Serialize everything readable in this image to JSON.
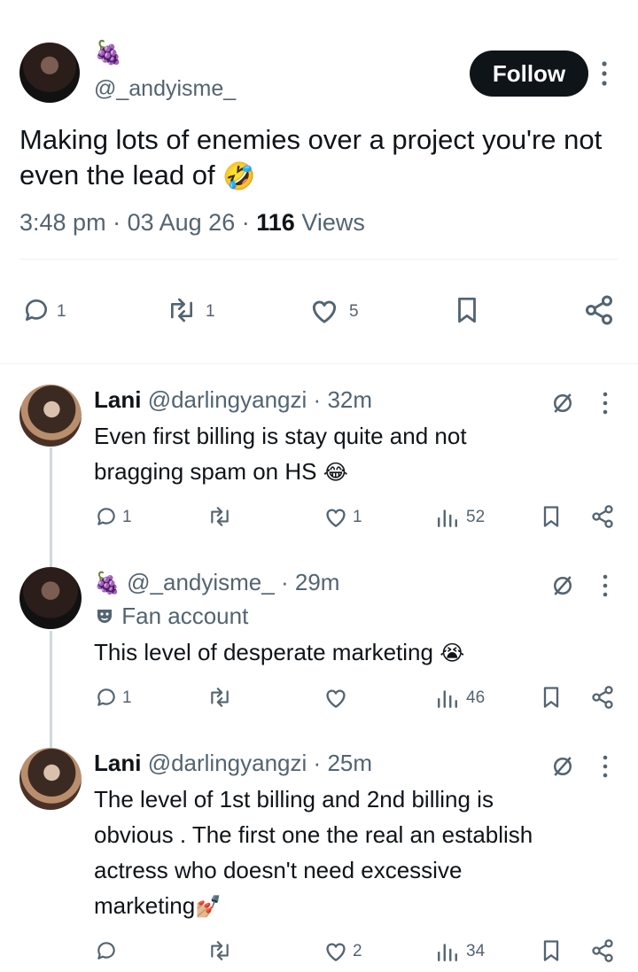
{
  "main_post": {
    "badge_emoji": "🍇",
    "handle": "@_andyisme_",
    "follow_label": "Follow",
    "text": "Making lots of enemies over a project you're not even the lead of",
    "text_emoji": "🤣",
    "time": "3:48 pm",
    "sep": "·",
    "date": "03 Aug 26",
    "views_count": "116",
    "views_label": "Views",
    "actions": {
      "replies": "1",
      "reposts": "1",
      "likes": "5"
    }
  },
  "replies": [
    {
      "name": "Lani",
      "handle": "@darlingyangzi",
      "sep": "·",
      "time": "32m",
      "text_line1": "Even first billing is stay quite and not",
      "text_line2": "bragging spam on HS",
      "emoji": "😂",
      "replies": "1",
      "reposts": "",
      "likes": "1",
      "views": "52"
    },
    {
      "name_emoji": "🍇",
      "handle": "@_andyisme_",
      "sep": "·",
      "time": "29m",
      "label_icon": "mask-icon",
      "label": "Fan account",
      "text_line1": "This level of desperate marketing",
      "emoji": "😭",
      "replies": "1",
      "reposts": "",
      "likes": "",
      "views": "46"
    },
    {
      "name": "Lani",
      "handle": "@darlingyangzi",
      "sep": "·",
      "time": "25m",
      "text_line1": "The level of 1st billing and 2nd billing is",
      "text_line2": "obvious . The first one the real an establish",
      "text_line3": "actress who doesn't need excessive",
      "text_line4": "marketing",
      "emoji": "💅🏼",
      "replies": "",
      "reposts": "",
      "likes": "2",
      "views": "34"
    }
  ],
  "colors": {
    "text": "#0f1419",
    "gray": "#536471",
    "divider": "#eff3f4",
    "thread": "#cfd9de"
  }
}
